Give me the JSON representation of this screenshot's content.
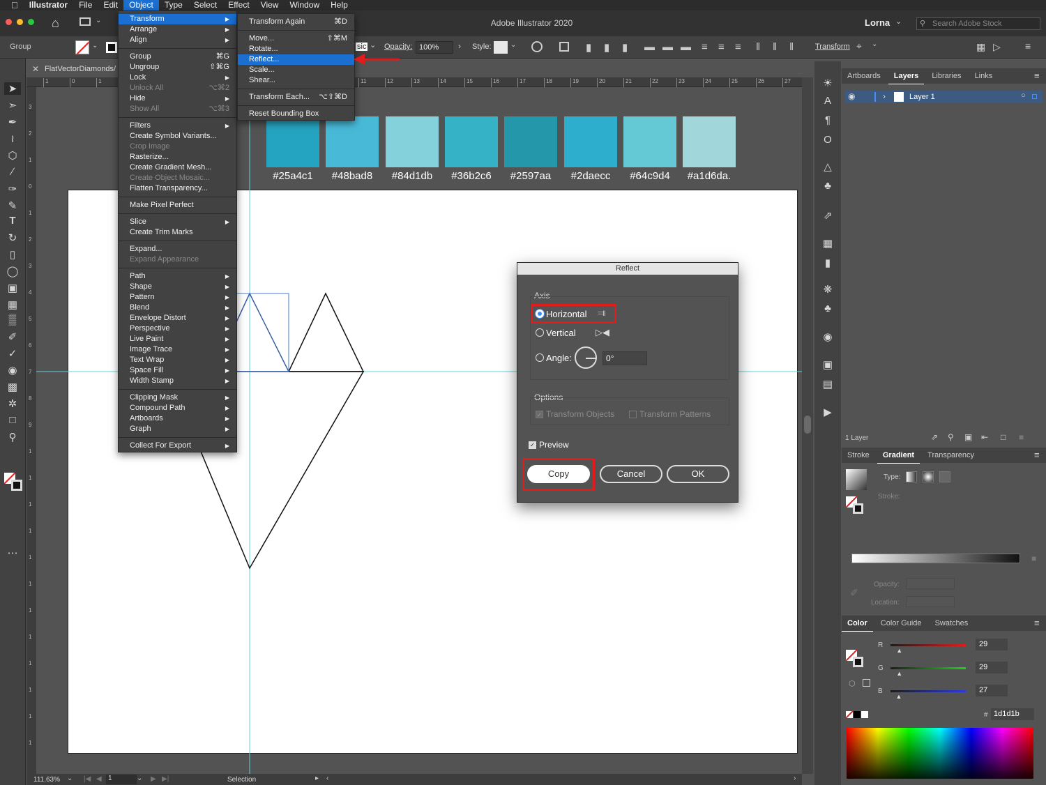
{
  "menubar": {
    "apple": "",
    "app_name": "Illustrator",
    "items": [
      "File",
      "Edit",
      "Object",
      "Type",
      "Select",
      "Effect",
      "View",
      "Window",
      "Help"
    ],
    "active": "Object"
  },
  "appbar": {
    "title": "Adobe Illustrator 2020",
    "user": "Lorna",
    "search_placeholder": "Search Adobe Stock"
  },
  "control": {
    "selection_label": "Group",
    "blend_mode_partial": "sic",
    "opacity_label": "Opacity:",
    "opacity_value": "100%",
    "style_label": "Style:",
    "transform_link": "Transform"
  },
  "document": {
    "tab_name": "FlatVectorDiamonds/",
    "ruler_ticks": [
      "1",
      "0",
      "1",
      "11",
      "12",
      "13",
      "14",
      "15",
      "16",
      "17",
      "18",
      "19",
      "20",
      "21",
      "22",
      "23",
      "24",
      "25",
      "26",
      "27"
    ],
    "ruler_v_ticks": [
      "3",
      "2",
      "1",
      "0",
      "1",
      "2",
      "3",
      "4",
      "5",
      "6",
      "7",
      "8",
      "9",
      "1",
      "1",
      "1",
      "1",
      "1",
      "1",
      "1",
      "1",
      "1",
      "1",
      "1",
      "1"
    ]
  },
  "swatches": [
    {
      "hex": "#25a4c1",
      "label": "#25a4c1"
    },
    {
      "hex": "#48bad8",
      "label": "#48bad8"
    },
    {
      "hex": "#84d1db",
      "label": "#84d1db"
    },
    {
      "hex": "#36b2c6",
      "label": "#36b2c6"
    },
    {
      "hex": "#2597aa",
      "label": "#2597aa"
    },
    {
      "hex": "#2daecc",
      "label": "#2daecc"
    },
    {
      "hex": "#64c9d4",
      "label": "#64c9d4"
    },
    {
      "hex": "#a1d6da",
      "label": "#a1d6da."
    }
  ],
  "object_menu": [
    {
      "label": "Transform",
      "arrow": "▶",
      "state": "sel"
    },
    {
      "label": "Arrange",
      "arrow": "▶"
    },
    {
      "label": "Align",
      "arrow": "▶"
    },
    {
      "sep": true
    },
    {
      "label": "Group",
      "shortcut": "⌘G"
    },
    {
      "label": "Ungroup",
      "shortcut": "⇧⌘G"
    },
    {
      "label": "Lock",
      "arrow": "▶"
    },
    {
      "label": "Unlock All",
      "shortcut": "⌥⌘2",
      "state": "dis"
    },
    {
      "label": "Hide",
      "arrow": "▶"
    },
    {
      "label": "Show All",
      "shortcut": "⌥⌘3",
      "state": "dis"
    },
    {
      "sep": true
    },
    {
      "label": "Filters",
      "arrow": "▶"
    },
    {
      "label": "Create Symbol Variants..."
    },
    {
      "label": "Crop Image",
      "state": "dis"
    },
    {
      "label": "Rasterize..."
    },
    {
      "label": "Create Gradient Mesh..."
    },
    {
      "label": "Create Object Mosaic...",
      "state": "dis"
    },
    {
      "label": "Flatten Transparency..."
    },
    {
      "sep": true
    },
    {
      "label": "Make Pixel Perfect"
    },
    {
      "sep": true
    },
    {
      "label": "Slice",
      "arrow": "▶"
    },
    {
      "label": "Create Trim Marks"
    },
    {
      "sep": true
    },
    {
      "label": "Expand..."
    },
    {
      "label": "Expand Appearance",
      "state": "dis"
    },
    {
      "sep": true
    },
    {
      "label": "Path",
      "arrow": "▶"
    },
    {
      "label": "Shape",
      "arrow": "▶"
    },
    {
      "label": "Pattern",
      "arrow": "▶"
    },
    {
      "label": "Blend",
      "arrow": "▶"
    },
    {
      "label": "Envelope Distort",
      "arrow": "▶"
    },
    {
      "label": "Perspective",
      "arrow": "▶"
    },
    {
      "label": "Live Paint",
      "arrow": "▶"
    },
    {
      "label": "Image Trace",
      "arrow": "▶"
    },
    {
      "label": "Text Wrap",
      "arrow": "▶"
    },
    {
      "label": "Space Fill",
      "arrow": "▶"
    },
    {
      "label": "Width Stamp",
      "arrow": "▶"
    },
    {
      "sep": true
    },
    {
      "label": "Clipping Mask",
      "arrow": "▶"
    },
    {
      "label": "Compound Path",
      "arrow": "▶"
    },
    {
      "label": "Artboards",
      "arrow": "▶"
    },
    {
      "label": "Graph",
      "arrow": "▶"
    },
    {
      "sep": true
    },
    {
      "label": "Collect For Export",
      "arrow": "▶"
    }
  ],
  "transform_menu": [
    {
      "label": "Transform Again",
      "shortcut": "⌘D"
    },
    {
      "sep": true
    },
    {
      "label": "Move...",
      "shortcut": "⇧⌘M"
    },
    {
      "label": "Rotate..."
    },
    {
      "label": "Reflect...",
      "state": "sel"
    },
    {
      "label": "Scale..."
    },
    {
      "label": "Shear..."
    },
    {
      "sep": true
    },
    {
      "label": "Transform Each...",
      "shortcut": "⌥⇧⌘D"
    },
    {
      "sep": true
    },
    {
      "label": "Reset Bounding Box"
    }
  ],
  "dialog": {
    "title": "Reflect",
    "axis_label": "Axis",
    "horizontal": "Horizontal",
    "vertical": "Vertical",
    "angle_label": "Angle:",
    "angle_value": "0°",
    "options_label": "Options",
    "transform_objects": "Transform Objects",
    "transform_patterns": "Transform Patterns",
    "preview": "Preview",
    "copy": "Copy",
    "cancel": "Cancel",
    "ok": "OK"
  },
  "layers_panel": {
    "tabs": [
      "Artboards",
      "Layers",
      "Libraries",
      "Links"
    ],
    "active_tab": "Layers",
    "layer_name": "Layer 1",
    "footer": "1 Layer"
  },
  "gradient_panel": {
    "tabs": [
      "Stroke",
      "Gradient",
      "Transparency"
    ],
    "active_tab": "Gradient",
    "type_label": "Type:",
    "stroke_label": "Stroke:",
    "opacity_label": "Opacity:",
    "location_label": "Location:"
  },
  "color_panel": {
    "tabs": [
      "Color",
      "Color Guide",
      "Swatches"
    ],
    "active_tab": "Color",
    "r_label": "R",
    "r_value": "29",
    "g_label": "G",
    "g_value": "29",
    "b_label": "B",
    "b_value": "27",
    "r_fraction": 0.114,
    "g_fraction": 0.114,
    "b_fraction": 0.106,
    "hex_label": "#",
    "hex_value": "1d1d1b"
  },
  "status": {
    "zoom": "111.63%",
    "artboard": "1",
    "tool": "Selection"
  },
  "colors": {
    "highlight": "#1a6fd1",
    "annotation_red": "#e41b1b",
    "guide": "#5fd3d9"
  }
}
